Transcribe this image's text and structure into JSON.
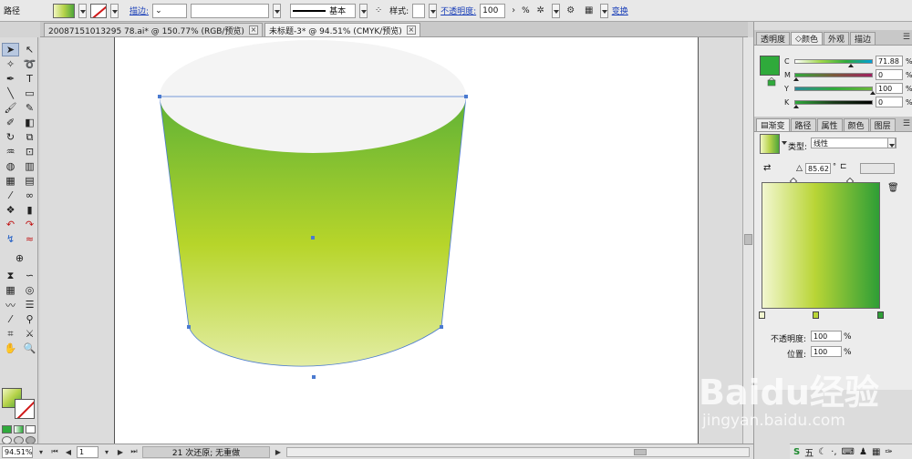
{
  "control_bar": {
    "object_type": "路径",
    "stroke_label": "描边:",
    "stroke_profile": "基本",
    "style_label": "样式:",
    "opacity_label": "不透明度:",
    "opacity_value": "100",
    "opacity_unit": "%",
    "transform_label": "变换"
  },
  "doc_tabs": [
    {
      "label": "20087151013295 78.ai* @ 150.77% (RGB/预览)",
      "active": false
    },
    {
      "label": "未标题-3* @ 94.51% (CMYK/预览)",
      "active": true
    }
  ],
  "color_panel": {
    "tabs": [
      "透明度",
      "颜色",
      "外观",
      "描边"
    ],
    "active_tab": "颜色",
    "channels": [
      {
        "name": "C",
        "value": "71.88",
        "marker": 0.72,
        "gradient": "linear-gradient(90deg,#ffffff,#9fd84a,#2faa3b,#00a0d8)"
      },
      {
        "name": "M",
        "value": "0",
        "marker": 0.0,
        "gradient": "linear-gradient(90deg,#2faa3b,#7a5a3a,#a02060)"
      },
      {
        "name": "Y",
        "value": "100",
        "marker": 1.0,
        "gradient": "linear-gradient(90deg,#2a8a9a,#2faa3b,#6ab83a)"
      },
      {
        "name": "K",
        "value": "0",
        "marker": 0.0,
        "gradient": "linear-gradient(90deg,#2faa3b,#1a3a1a,#000000)"
      }
    ],
    "fill_color": "#2faa3b"
  },
  "gradient_panel": {
    "tabs": [
      "渐变",
      "路径",
      "属性",
      "颜色",
      "图层"
    ],
    "active_tab": "渐变",
    "type_label": "类型:",
    "type_value": "线性",
    "angle_value": "85.62",
    "angle_unit": "°",
    "opacity_label": "不透明度:",
    "opacity_value": "100",
    "location_label": "位置:",
    "location_value": "100",
    "pct": "%",
    "stops": [
      {
        "position": 0.0,
        "color": "#f2f7d0"
      },
      {
        "position": 0.45,
        "color": "#b9d536"
      },
      {
        "position": 1.0,
        "color": "#2e9e36"
      }
    ]
  },
  "status_bar": {
    "zoom": "94.51%",
    "page": "1",
    "message": "21 次还原; 无重做"
  },
  "watermark": {
    "logo": "Baidu经验",
    "url": "jingyan.baidu.com"
  },
  "tray": {
    "ime": "五"
  }
}
